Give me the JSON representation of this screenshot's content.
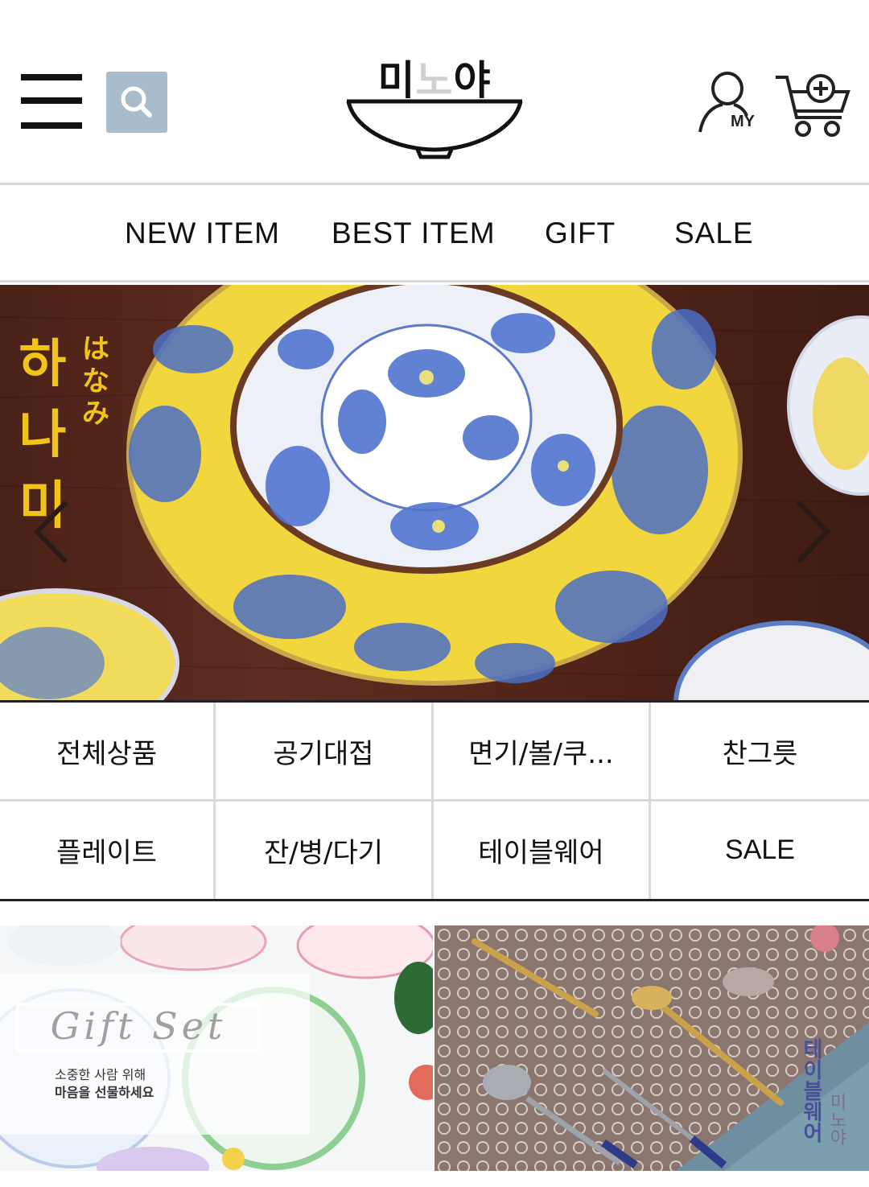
{
  "header": {
    "logo_text_left": "미",
    "logo_text_mid": "노",
    "logo_text_right": "야",
    "icons": [
      "menu-icon",
      "search-icon",
      "my-page-icon",
      "cart-icon"
    ],
    "my_label": "MY"
  },
  "topnav": {
    "items": [
      {
        "label": "NEW ITEM"
      },
      {
        "label": "BEST ITEM"
      },
      {
        "label": "GIFT"
      },
      {
        "label": "SALE"
      }
    ]
  },
  "banner": {
    "title": "하나미",
    "subtitle": "はなみ",
    "prev_icon": "chevron-left-icon",
    "next_icon": "chevron-right-icon"
  },
  "categories": [
    {
      "label": "전체상품"
    },
    {
      "label": "공기대접"
    },
    {
      "label": "면기/볼/쿠..."
    },
    {
      "label": "찬그릇"
    },
    {
      "label": "플레이트"
    },
    {
      "label": "잔/병/다기"
    },
    {
      "label": "테이블웨어"
    },
    {
      "label": "SALE"
    }
  ],
  "promos": {
    "gift": {
      "title": "Gift Set",
      "line1": "소중한 사람 위해",
      "line2": "마음을 선물하세요"
    },
    "tableware": {
      "title": "테이블웨어",
      "brand": "미노야"
    }
  },
  "colors": {
    "accent_search": "#a9bccb",
    "banner_text": "#f0c419",
    "divider": "#d9d9d9"
  }
}
